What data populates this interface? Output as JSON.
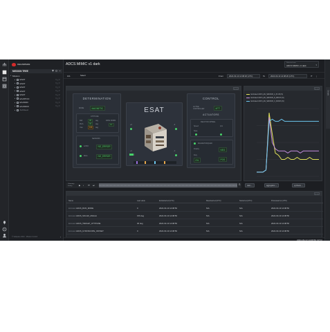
{
  "colors": {
    "bg": "#1c1e22",
    "accent": "#d42b2b",
    "ok_green": "#47d36a",
    "series": [
      "#e3e35a",
      "#c58ee0",
      "#6cc7ef"
    ]
  },
  "rail": {
    "icons": [
      "tree-icon",
      "dashboard-icon",
      "panel-icon",
      "settings-icon",
      "bell-icon",
      "help-icon",
      "user-icon"
    ]
  },
  "sidebar": {
    "logo_text": "VALISPACE",
    "tree_title": "MISSION TREE",
    "root": "Mission",
    "items": [
      {
        "label": "ESAT"
      },
      {
        "label": "ESAT"
      },
      {
        "label": "ESAT"
      },
      {
        "label": "ESAT"
      },
      {
        "label": "ESAT"
      },
      {
        "label": "ES-BTOO"
      },
      {
        "label": "ES-BFID"
      },
      {
        "label": "ES-BFDX"
      }
    ],
    "archived": "Archived",
    "footer": "© Valispace 2024 · Mission Control"
  },
  "header": {
    "title": "ADCS MIMIC v1 dark",
    "select_label": "Selected view",
    "select_value": "ADCS MIMIC v1 dark"
  },
  "filters": {
    "gs_label": "GS",
    "gs_value": "Select",
    "from_label": "From",
    "from_value": "2024-03-13 14:08:26 (UTC)",
    "to_label": "To",
    "to_value": "2024-03-13 14:08:26 (UTC)"
  },
  "mimic": {
    "determination": {
      "title": "DETERMINATION",
      "mode_label": "MODE",
      "mode_value": "MAGNETIC",
      "attitude_title": "ATTITUDE",
      "roll_label": "Roll",
      "roll_value": "38",
      "roll_unit": "deg",
      "pitch_label": "Pitch",
      "pitch_value": "39",
      "pitch_unit": "deg",
      "yaw_label": "Yaw",
      "yaw_value": "166",
      "yaw_unit": "deg",
      "rate_label": "RATE NORM",
      "rate_value": "0.1",
      "sensors_title": "SENSORS",
      "sensor1_label": "GYRO",
      "sensor1_value": "NO_ERROR",
      "sensor2_label": "MAG",
      "sensor2_value": "NO_ERROR"
    },
    "esat": {
      "title": "ESAT",
      "pz_label": "+Z",
      "mz_label": "-Z",
      "px_label": "+X",
      "mx_label": "-X",
      "py_label": "+Y",
      "my_label": "-Y"
    },
    "control": {
      "title": "CONTROL",
      "ctrl_label": "ACTIVE CONTROLLER",
      "ctrl_value": "MTT",
      "actuators_title": "ACTUATORS",
      "wheel_label": "REACTION WHEEL",
      "wheel_speed_label": "Speed",
      "wheel_speed_value": "rpm",
      "wheel_state_label": "State",
      "mtq_label": "MAGNETORQUER",
      "mtq_x_label": "Polarity",
      "mtq_x_value": "NEG",
      "mtq_y_label": "Duty",
      "mtq_y_value": "0%",
      "mtq_z_value": "POS"
    }
  },
  "timeline": {
    "label": "Telemetry history"
  },
  "chart_panel": {
    "legend": [
      "Estimated ADCS_ES_SENSOR_A_PLUS [%]",
      "Estimated ADCS_ES_SENSOR_B_MINUS [%]",
      "Estimated ADCS_ES_SENSOR_C_MINUS [%]"
    ],
    "buttons": {
      "stats": "stats ⌄",
      "aggregation": "aggregation ⌄",
      "synthesis": "synthesis ⌄"
    }
  },
  "chart_data": {
    "type": "line",
    "x": [
      0,
      1,
      2,
      3,
      4,
      5,
      6,
      7,
      8,
      9,
      10,
      11,
      12,
      13,
      14,
      15,
      16,
      17,
      18,
      19,
      20
    ],
    "series": [
      {
        "name": "Estimated ADCS_ES_SENSOR_A_PLUS [%]",
        "color": "#e3e35a",
        "values": [
          0.2,
          0.2,
          0.2,
          0.3,
          3.0,
          2.0,
          1.1,
          1.0,
          0.8,
          0.8,
          0.9,
          0.8,
          0.8,
          0.9,
          0.8,
          0.8,
          0.8,
          0.9,
          0.8,
          0.8,
          0.8
        ]
      },
      {
        "name": "Estimated ADCS_ES_SENSOR_B_MINUS [%]",
        "color": "#c58ee0",
        "values": [
          0.2,
          0.2,
          0.2,
          0.3,
          2.8,
          1.6,
          1.3,
          1.2,
          1.2,
          1.2,
          1.1,
          1.2,
          1.2,
          1.2,
          1.1,
          1.2,
          1.2,
          1.2,
          1.2,
          1.2,
          1.2
        ]
      },
      {
        "name": "Estimated ADCS_ES_SENSOR_C_MINUS [%]",
        "color": "#6cc7ef",
        "values": [
          0.2,
          0.2,
          0.2,
          0.3,
          2.6,
          2.7,
          2.6,
          2.6,
          2.7,
          2.6,
          2.6,
          2.6,
          2.6,
          2.6,
          2.6,
          2.6,
          2.6,
          2.6,
          2.6,
          2.6,
          2.6
        ]
      }
    ],
    "ylim": [
      0,
      3.2
    ],
    "grid": true,
    "legend_position": "top-left"
  },
  "table": {
    "columns": [
      "Name",
      "Last value",
      "Extracted at (UTC)",
      "Received at (UTC)",
      "Stored at (UTC)",
      "Processed at (UTC)"
    ],
    "rows": [
      {
        "prefix": "Estimated",
        "name": "ADCS_RUN_MODE",
        "value": "0",
        "extracted": "2024-03-13 14:08:56",
        "received": "N/A",
        "stored": "N/A",
        "processed": "2024-03-13 14:08:56"
      },
      {
        "prefix": "Estimated",
        "name": "ADCS_SOLAR_ANGLE",
        "value": "156 deg",
        "extracted": "2024-03-13 14:08:56",
        "received": "N/A",
        "stored": "N/A",
        "processed": "2024-03-13 14:08:56"
      },
      {
        "prefix": "Estimated",
        "name": "ADCS_TARGET_ATTITUDE",
        "value": "30 deg",
        "extracted": "2024-03-13 14:08:56",
        "received": "N/A",
        "stored": "N/A",
        "processed": "2024-03-13 14:08:56"
      },
      {
        "prefix": "Estimated",
        "name": "ADCS_GYROSCOPE_OFFSET",
        "value": "0",
        "extracted": "2024-03-13 14:08:56",
        "received": "N/A",
        "stored": "N/A",
        "processed": "2024-03-13 14:08:56"
      }
    ]
  },
  "status": {
    "clock": "2024-03-13 14:08:56 (UTC)"
  },
  "right_panel": {
    "label": "Details"
  }
}
